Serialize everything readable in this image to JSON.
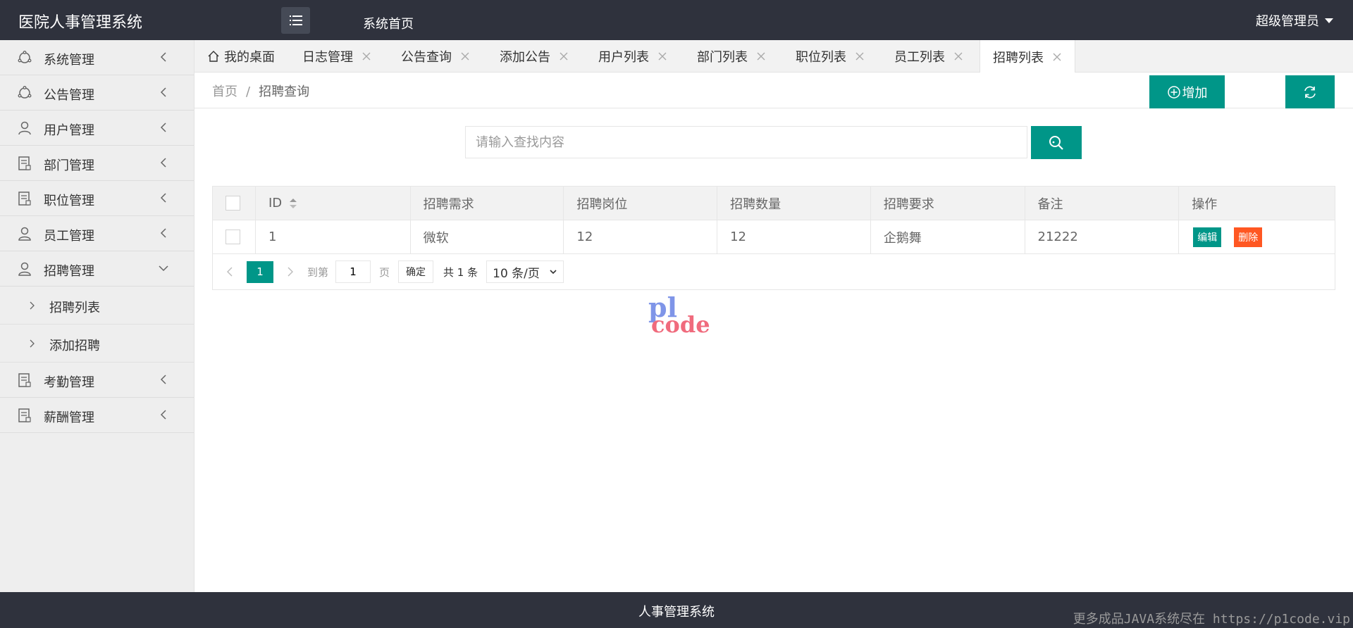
{
  "header": {
    "app_title": "医院人事管理系统",
    "home_link": "系统首页",
    "user_name": "超级管理员"
  },
  "sidebar": {
    "items": [
      {
        "label": "系统管理",
        "icon": "settings-icon",
        "expanded": false
      },
      {
        "label": "公告管理",
        "icon": "settings-icon",
        "expanded": false
      },
      {
        "label": "用户管理",
        "icon": "user-icon",
        "expanded": false
      },
      {
        "label": "部门管理",
        "icon": "document-icon",
        "expanded": false
      },
      {
        "label": "职位管理",
        "icon": "document-icon",
        "expanded": false
      },
      {
        "label": "员工管理",
        "icon": "user-card-icon",
        "expanded": false
      },
      {
        "label": "招聘管理",
        "icon": "user-icon",
        "expanded": true
      },
      {
        "label": "考勤管理",
        "icon": "document-icon",
        "expanded": false
      },
      {
        "label": "薪酬管理",
        "icon": "document-icon",
        "expanded": false
      }
    ],
    "sub_items": [
      {
        "label": "招聘列表"
      },
      {
        "label": "添加招聘"
      }
    ]
  },
  "tabs": [
    {
      "label": "我的桌面",
      "closable": false,
      "active": false
    },
    {
      "label": "日志管理",
      "closable": true,
      "active": false
    },
    {
      "label": "公告查询",
      "closable": true,
      "active": false
    },
    {
      "label": "添加公告",
      "closable": true,
      "active": false
    },
    {
      "label": "用户列表",
      "closable": true,
      "active": false
    },
    {
      "label": "部门列表",
      "closable": true,
      "active": false
    },
    {
      "label": "职位列表",
      "closable": true,
      "active": false
    },
    {
      "label": "员工列表",
      "closable": true,
      "active": false
    },
    {
      "label": "招聘列表",
      "closable": true,
      "active": true
    }
  ],
  "breadcrumb": {
    "home": "首页",
    "separator": "/",
    "current": "招聘查询"
  },
  "toolbar": {
    "add_label": "增加"
  },
  "search": {
    "placeholder": "请输入查找内容",
    "value": ""
  },
  "table": {
    "columns": [
      "ID",
      "招聘需求",
      "招聘岗位",
      "招聘数量",
      "招聘要求",
      "备注",
      "操作"
    ],
    "rows": [
      {
        "id": "1",
        "demand": "微软",
        "position": "12",
        "count": "12",
        "requirement": "企鹅舞",
        "remark": "21222"
      }
    ],
    "edit_label": "编辑",
    "delete_label": "删除"
  },
  "pagination": {
    "current_page": "1",
    "goto_label": "到第",
    "goto_value": "1",
    "page_unit": "页",
    "confirm_label": "确定",
    "total_label": "共 1 条",
    "page_size": "10 条/页"
  },
  "footer": {
    "text": "人事管理系统",
    "note": "更多成品JAVA系统尽在 https://p1code.vip"
  },
  "colors": {
    "primary": "#009688",
    "danger": "#ff5722",
    "header_bg": "#2f323d"
  }
}
